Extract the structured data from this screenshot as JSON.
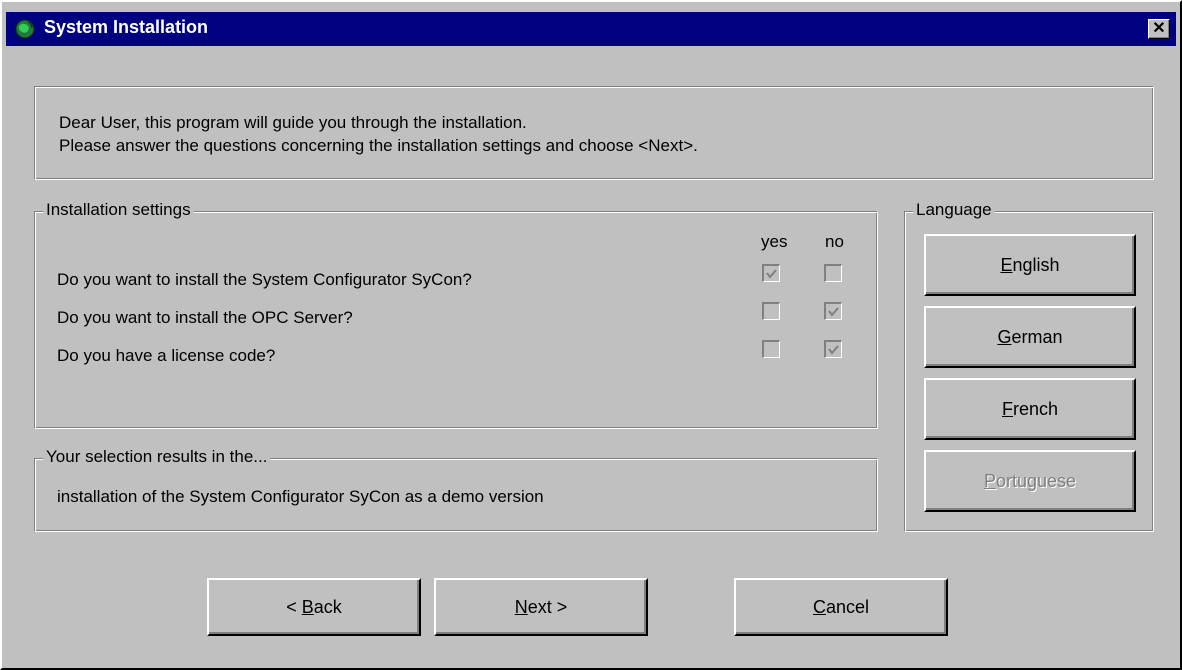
{
  "window": {
    "title": "System Installation",
    "close_glyph": "✕"
  },
  "intro": {
    "line1": "Dear User, this program will guide you through the installation.",
    "line2": "Please answer the questions concerning the installation settings and choose <Next>."
  },
  "settings": {
    "legend": "Installation settings",
    "col_yes": "yes",
    "col_no": "no",
    "questions": [
      {
        "text": "Do you want to install the System Configurator SyCon?",
        "yes": true,
        "no": false
      },
      {
        "text": "Do you want to install the OPC Server?",
        "yes": false,
        "no": true
      },
      {
        "text": "Do you have a license code?",
        "yes": false,
        "no": true
      }
    ]
  },
  "result": {
    "legend": "Your selection results in the...",
    "text": "installation of the System Configurator SyCon as a demo version"
  },
  "language": {
    "legend": "Language",
    "buttons": [
      {
        "label": "English",
        "mnemonic": "E",
        "rest": "nglish",
        "enabled": true
      },
      {
        "label": "German",
        "mnemonic": "G",
        "rest": "erman",
        "enabled": true
      },
      {
        "label": "French",
        "mnemonic": "F",
        "rest": "rench",
        "enabled": true
      },
      {
        "label": "Portuguese",
        "mnemonic": "P",
        "rest": "ortuguese",
        "enabled": false
      }
    ]
  },
  "footer": {
    "back": {
      "prefix": "< ",
      "mnemonic": "B",
      "rest": "ack"
    },
    "next": {
      "prefix": "",
      "mnemonic": "N",
      "rest": "ext >"
    },
    "cancel": {
      "prefix": "",
      "mnemonic": "C",
      "rest": "ancel"
    }
  },
  "colors": {
    "titlebar": "#000080",
    "face": "#c0c0c0",
    "disabled_check": "#808080"
  }
}
